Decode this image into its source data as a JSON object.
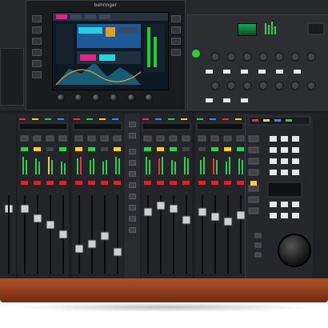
{
  "brand": {
    "name": "behringer"
  },
  "colors": {
    "wood": "#8a3a1a",
    "screen_accent_pink": "#e0248a",
    "screen_accent_cyan": "#2ad0e0",
    "led_green": "#33cc55",
    "led_yellow": "#ffcc33",
    "led_red": "#ee3333",
    "led_blue": "#3388ff"
  },
  "icons": [
    "jog-wheel-icon",
    "fader-cap-icon",
    "rotary-knob-icon"
  ]
}
